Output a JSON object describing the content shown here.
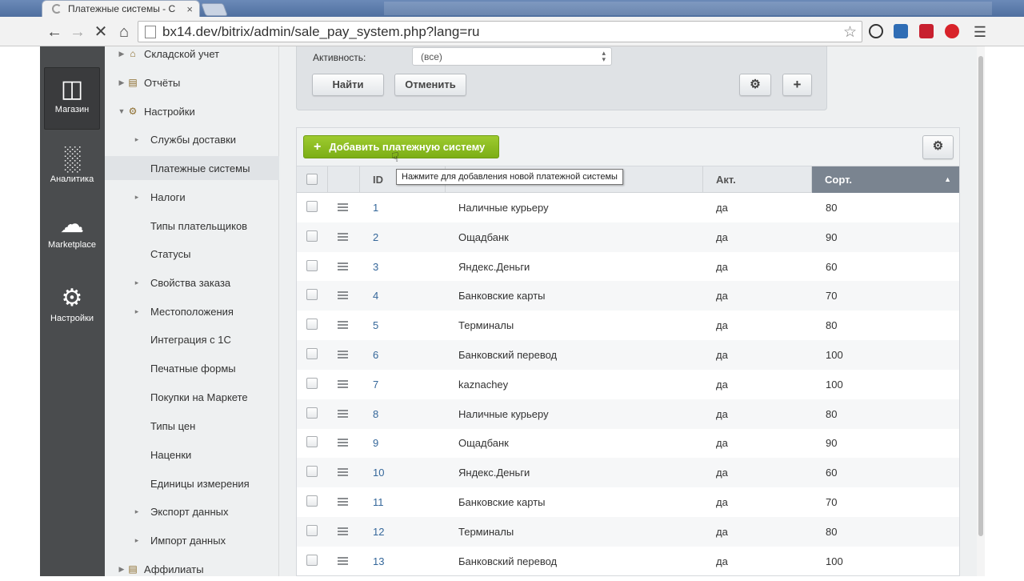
{
  "browser": {
    "tab_title": "Платежные системы - C",
    "url": "bx14.dev/bitrix/admin/sale_pay_system.php?lang=ru"
  },
  "leftbar": {
    "items": [
      {
        "label": "Магазин",
        "icon": "basket-icon"
      },
      {
        "label": "Аналитика",
        "icon": "bar-chart-icon"
      },
      {
        "label": "Marketplace",
        "icon": "cloud-download-icon"
      },
      {
        "label": "Настройки",
        "icon": "gear-icon"
      }
    ]
  },
  "sidebar": {
    "items": [
      {
        "label": "Складской учет",
        "level": 0,
        "icon": "warehouse-icon"
      },
      {
        "label": "Отчёты",
        "level": 0,
        "icon": "report-icon"
      },
      {
        "label": "Настройки",
        "level": 0,
        "icon": "settings-icon",
        "expanded": true
      },
      {
        "label": "Службы доставки",
        "level": 1
      },
      {
        "label": "Платежные системы",
        "level": 1,
        "active": true
      },
      {
        "label": "Налоги",
        "level": 1
      },
      {
        "label": "Типы плательщиков",
        "level": 1
      },
      {
        "label": "Статусы",
        "level": 1
      },
      {
        "label": "Свойства заказа",
        "level": 1
      },
      {
        "label": "Местоположения",
        "level": 1
      },
      {
        "label": "Интеграция с 1С",
        "level": 1
      },
      {
        "label": "Печатные формы",
        "level": 1
      },
      {
        "label": "Покупки на Маркете",
        "level": 1
      },
      {
        "label": "Типы цен",
        "level": 1
      },
      {
        "label": "Наценки",
        "level": 1
      },
      {
        "label": "Единицы измерения",
        "level": 1
      },
      {
        "label": "Экспорт данных",
        "level": 1
      },
      {
        "label": "Импорт данных",
        "level": 1
      },
      {
        "label": "Аффилиаты",
        "level": 0,
        "icon": "affiliate-icon"
      }
    ]
  },
  "filter": {
    "activity_label": "Активность:",
    "activity_value": "(все)",
    "find_label": "Найти",
    "cancel_label": "Отменить"
  },
  "grid": {
    "add_button_label": "Добавить платежную систему",
    "tooltip": "Нажмите для добавления новой платежной системы",
    "columns": {
      "id": "ID",
      "active": "Акт.",
      "sort": "Сорт."
    },
    "rows": [
      {
        "id": "1",
        "name": "Наличные курьеру",
        "active": "да",
        "sort": "80"
      },
      {
        "id": "2",
        "name": "Ощадбанк",
        "active": "да",
        "sort": "90"
      },
      {
        "id": "3",
        "name": "Яндекс.Деньги",
        "active": "да",
        "sort": "60"
      },
      {
        "id": "4",
        "name": "Банковские карты",
        "active": "да",
        "sort": "70"
      },
      {
        "id": "5",
        "name": "Терминалы",
        "active": "да",
        "sort": "80"
      },
      {
        "id": "6",
        "name": "Банковский перевод",
        "active": "да",
        "sort": "100"
      },
      {
        "id": "7",
        "name": "kaznachey",
        "active": "да",
        "sort": "100"
      },
      {
        "id": "8",
        "name": "Наличные курьеру",
        "active": "да",
        "sort": "80"
      },
      {
        "id": "9",
        "name": "Ощадбанк",
        "active": "да",
        "sort": "90"
      },
      {
        "id": "10",
        "name": "Яндекс.Деньги",
        "active": "да",
        "sort": "60"
      },
      {
        "id": "11",
        "name": "Банковские карты",
        "active": "да",
        "sort": "70"
      },
      {
        "id": "12",
        "name": "Терминалы",
        "active": "да",
        "sort": "80"
      },
      {
        "id": "13",
        "name": "Банковский перевод",
        "active": "да",
        "sort": "100"
      }
    ]
  }
}
